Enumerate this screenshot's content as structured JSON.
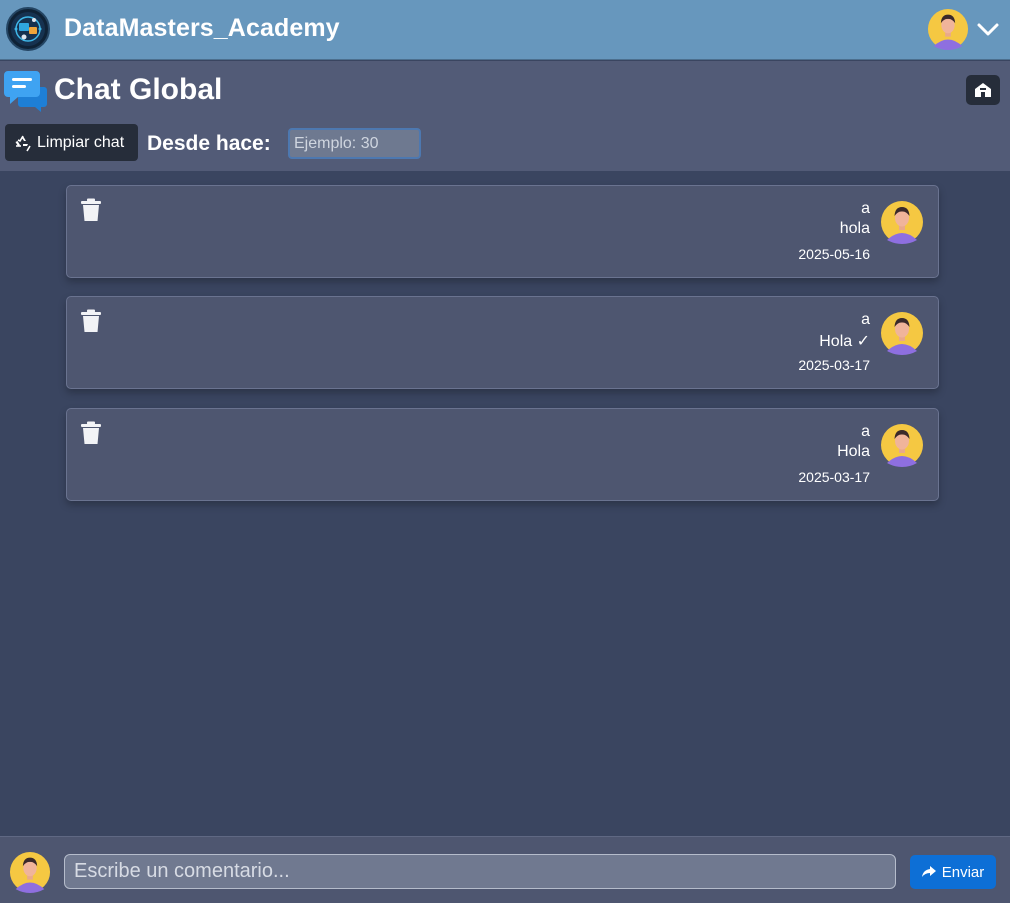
{
  "header": {
    "brand": "DataMasters_Academy",
    "logo_icon": "academy-logo-icon",
    "avatar_icon": "user-avatar-icon",
    "menu_icon": "chevron-down-icon"
  },
  "chat": {
    "title": "Chat Global",
    "title_icon": "chat-bubbles-icon",
    "home_icon": "home-icon",
    "clear_label": "Limpiar chat",
    "clear_icon": "recycle-icon",
    "since_label": "Desde hace:",
    "since_placeholder": "Ejemplo: 30"
  },
  "messages": [
    {
      "author": "a",
      "text": "hola",
      "date": "2025-05-16"
    },
    {
      "author": "a",
      "text": "Hola ✓",
      "date": "2025-03-17"
    },
    {
      "author": "a",
      "text": "Hola",
      "date": "2025-03-17"
    }
  ],
  "composer": {
    "placeholder": "Escribe un comentario...",
    "send_label": "Enviar",
    "send_icon": "share-arrow-icon"
  },
  "colors": {
    "topbar": "#6797bd",
    "subheader": "#525b77",
    "background": "#3a4560",
    "message_card": "#4e5670",
    "send_button": "#0d6fd6"
  }
}
